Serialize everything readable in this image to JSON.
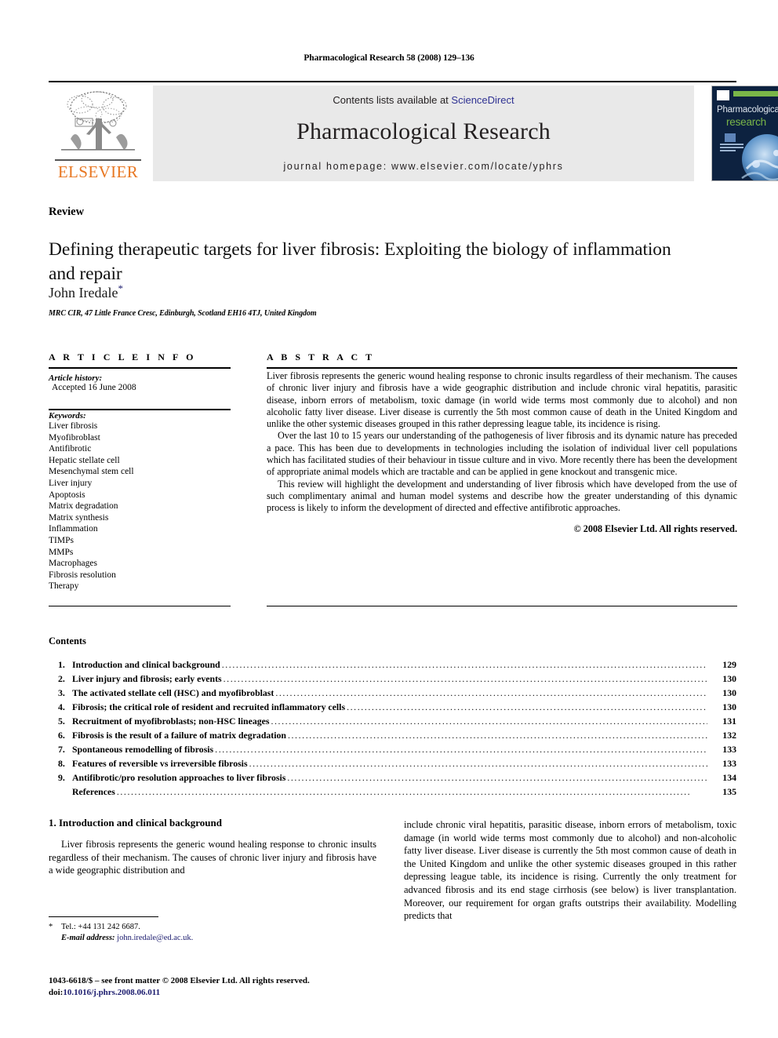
{
  "running_head": "Pharmacological Research 58 (2008) 129–136",
  "masthead": {
    "publisher_name": "ELSEVIER",
    "contents_line_prefix": "Contents lists available at ",
    "sciencedirect": "ScienceDirect",
    "journal_title": "Pharmacological Research",
    "homepage_line": "journal homepage: www.elsevier.com/locate/yphrs",
    "cover": {
      "title_line1": "Pharmacological",
      "title_line2": "research"
    },
    "colors": {
      "elsevier_orange": "#e87722",
      "sciencedirect_blue": "#2e3192",
      "cover_navy": "#0d2240",
      "cover_green": "#7ab648",
      "banner_grey": "#e9e9e9"
    }
  },
  "article": {
    "type": "Review",
    "title": "Defining therapeutic targets for liver fibrosis: Exploiting the biology of inflammation and repair",
    "author": "John Iredale",
    "author_marker": "*",
    "affiliation": "MRC CIR, 47 Little France Cresc, Edinburgh, Scotland EH16 4TJ, United Kingdom"
  },
  "info": {
    "heading": "A R T I C L E   I N F O",
    "history_label": "Article history:",
    "history_value": "Accepted 16 June 2008",
    "keywords_label": "Keywords:",
    "keywords": [
      "Liver fibrosis",
      "Myofibroblast",
      "Antifibrotic",
      "Hepatic stellate cell",
      "Mesenchymal stem cell",
      "Liver injury",
      "Apoptosis",
      "Matrix degradation",
      "Matrix synthesis",
      "Inflammation",
      "TIMPs",
      "MMPs",
      "Macrophages",
      "Fibrosis resolution",
      "Therapy"
    ]
  },
  "abstract": {
    "heading": "A B S T R A C T",
    "paragraphs": [
      "Liver fibrosis represents the generic wound healing response to chronic insults regardless of their mechanism. The causes of chronic liver injury and fibrosis have a wide geographic distribution and include chronic viral hepatitis, parasitic disease, inborn errors of metabolism, toxic damage (in world wide terms most commonly due to alcohol) and non alcoholic fatty liver disease. Liver disease is currently the 5th most common cause of death in the United Kingdom and unlike the other systemic diseases grouped in this rather depressing league table, its incidence is rising.",
      "Over the last 10 to 15 years our understanding of the pathogenesis of liver fibrosis and its dynamic nature has preceded a pace. This has been due to developments in technologies including the isolation of individual liver cell populations which has facilitated studies of their behaviour in tissue culture and in vivo. More recently there has been the development of appropriate animal models which are tractable and can be applied in gene knockout and transgenic mice.",
      "This review will highlight the development and understanding of liver fibrosis which have developed from the use of such complimentary animal and human model systems and describe how the greater understanding of this dynamic process is likely to inform the development of directed and effective antifibrotic approaches."
    ],
    "copyright": "© 2008 Elsevier Ltd. All rights reserved."
  },
  "contents": {
    "heading": "Contents",
    "items": [
      {
        "num": "1.",
        "label": "Introduction and clinical background",
        "page": "129"
      },
      {
        "num": "2.",
        "label": "Liver injury and fibrosis; early events",
        "page": "130"
      },
      {
        "num": "3.",
        "label": "The activated stellate cell (HSC) and myofibroblast",
        "page": "130"
      },
      {
        "num": "4.",
        "label": "Fibrosis; the critical role of resident and recruited inflammatory cells",
        "page": "130"
      },
      {
        "num": "5.",
        "label": "Recruitment of myofibroblasts; non-HSC lineages",
        "page": "131"
      },
      {
        "num": "6.",
        "label": "Fibrosis is the result of a failure of matrix degradation",
        "page": "132"
      },
      {
        "num": "7.",
        "label": "Spontaneous remodelling of fibrosis",
        "page": "133"
      },
      {
        "num": "8.",
        "label": "Features of reversible vs irreversible fibrosis",
        "page": "133"
      },
      {
        "num": "9.",
        "label": "Antifibrotic/pro resolution approaches to liver fibrosis",
        "page": "134"
      },
      {
        "num": "",
        "label": "References",
        "page": "135"
      }
    ]
  },
  "body": {
    "section_heading": "1.  Introduction and clinical background",
    "left_column": "Liver fibrosis represents the generic wound healing response to chronic insults regardless of their mechanism. The causes of chronic liver injury and fibrosis have a wide geographic distribution and",
    "right_column": "include chronic viral hepatitis, parasitic disease, inborn errors of metabolism, toxic damage (in world wide terms most commonly due to alcohol) and non-alcoholic fatty liver disease. Liver disease is currently the 5th most common cause of death in the United Kingdom and unlike the other systemic diseases grouped in this rather depressing league table, its incidence is rising. Currently the only treatment for advanced fibrosis and its end stage cirrhosis (see below) is liver transplantation. Moreover, our requirement for organ grafts outstrips their availability. Modelling predicts that"
  },
  "footnote": {
    "marker": "*",
    "tel": "Tel.: +44 131 242 6687.",
    "email_label": "E-mail address:",
    "email": "john.iredale@ed.ac.uk."
  },
  "footer": {
    "issn_line": "1043-6618/$ – see front matter © 2008 Elsevier Ltd. All rights reserved.",
    "doi_label": "doi:",
    "doi_value": "10.1016/j.phrs.2008.06.011"
  }
}
